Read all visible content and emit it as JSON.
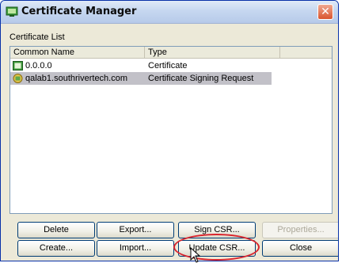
{
  "window": {
    "title": "Certificate Manager"
  },
  "section": {
    "label": "Certificate List"
  },
  "list": {
    "columns": [
      "Common Name",
      "Type",
      ""
    ],
    "rows": [
      {
        "name": "0.0.0.0",
        "type": "Certificate",
        "icon": "certificate-icon",
        "selected": false
      },
      {
        "name": "qalab1.southrivertech.com",
        "type": "Certificate Signing Request",
        "icon": "csr-icon",
        "selected": true
      }
    ]
  },
  "buttons": {
    "delete": "Delete",
    "export": "Export...",
    "sign_csr": "Sign CSR...",
    "properties": "Properties...",
    "create": "Create...",
    "import": "Import...",
    "update_csr": "Update CSR...",
    "close": "Close"
  },
  "colors": {
    "title_gradient_top": "#dfe9f7",
    "close_button": "#d9542f",
    "selection": "#c2c1c8",
    "highlight": "#d9242d"
  }
}
